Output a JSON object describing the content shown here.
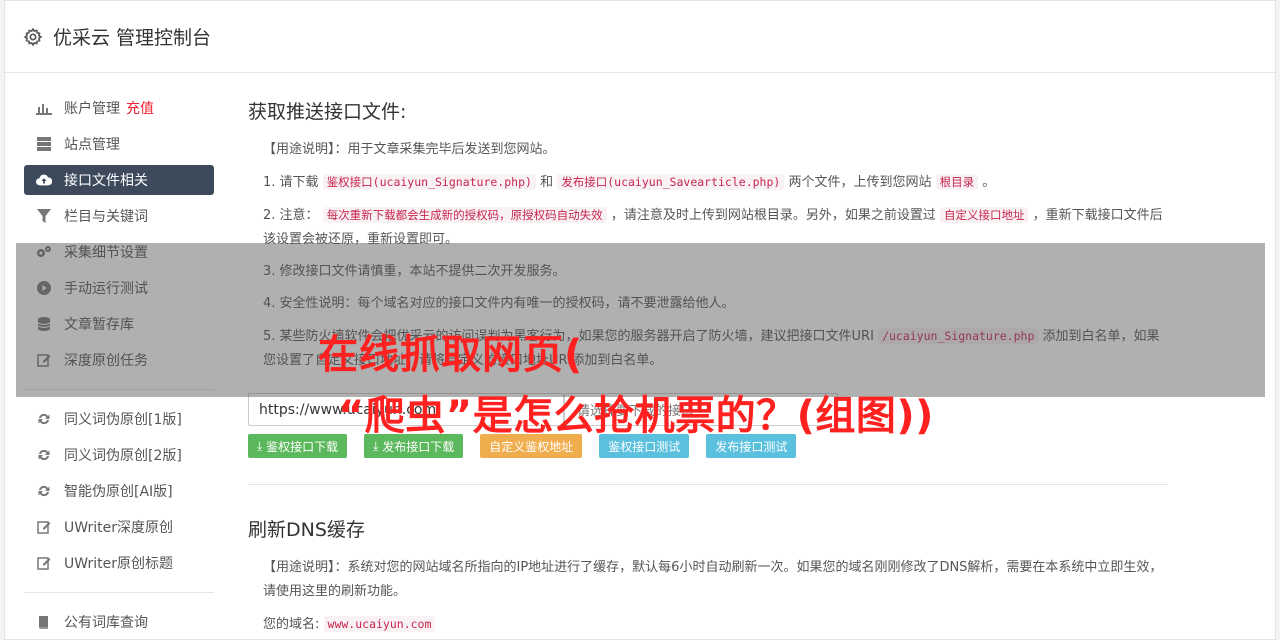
{
  "header": {
    "title": "优采云 管理控制台"
  },
  "sidebar": {
    "group1": [
      {
        "label": "账户管理",
        "badge": "充值",
        "icon": "bar-chart-icon"
      },
      {
        "label": "站点管理",
        "icon": "server-icon"
      },
      {
        "label": "接口文件相关",
        "icon": "cloud-upload-icon",
        "active": true
      },
      {
        "label": "栏目与关键词",
        "icon": "filter-icon"
      },
      {
        "label": "采集细节设置",
        "icon": "gears-icon"
      },
      {
        "label": "手动运行测试",
        "icon": "play-icon"
      },
      {
        "label": "文章暂存库",
        "icon": "database-icon"
      },
      {
        "label": "深度原创任务",
        "icon": "edit-icon"
      }
    ],
    "group2": [
      {
        "label": "同义词伪原创[1版]",
        "icon": "refresh-icon"
      },
      {
        "label": "同义词伪原创[2版]",
        "icon": "refresh-icon"
      },
      {
        "label": "智能伪原创[AI版]",
        "icon": "refresh-icon"
      },
      {
        "label": "UWriter深度原创",
        "icon": "edit-icon"
      },
      {
        "label": "UWriter原创标题",
        "icon": "edit-icon"
      }
    ],
    "group3": [
      {
        "label": "公有词库查询",
        "icon": "book-icon"
      }
    ]
  },
  "section1": {
    "title": "获取推送接口文件:",
    "usage": "【用途说明】：用于文章采集完毕后发送到您网站。",
    "step1_prefix": "1. 请下载",
    "step1_code1": "鉴权接口(ucaiyun_Signature.php)",
    "step1_and": "和",
    "step1_code2": "发布接口(ucaiyun_Savearticle.php)",
    "step1_suffix": "两个文件，上传到您网站",
    "step1_code3": "根目录",
    "step1_end": "。",
    "step2_prefix": "2. 注意：",
    "step2_code1": "每次重新下载都会生成新的授权码，原授权码自动失效",
    "step2_mid": "，请注意及时上传到网站根目录。另外，如果之前设置过",
    "step2_code2": "自定义接口地址",
    "step2_suffix": "，重新下载接口文件后该设置会被还原，重新设置即可。",
    "step3": "3. 修改接口文件请慎重，本站不提供二次开发服务。",
    "step4": "4. 安全性说明：每个域名对应的接口文件内有唯一的授权码，请不要泄露给他人。",
    "step5_prefix": "5. 某些防火墙软件会把优采云的访问误判为黑客行为，如果您的服务器开启了防火墙，建议把接口文件URI",
    "step5_code": "/ucaiyun_Signature.php",
    "step5_suffix": "添加到白名单，如果您设置了自定义接口地址，请将自定义的接口地址URI添加到白名单。",
    "url_value": "https://www.ucaiyun.com",
    "select_placeholder": "请选择要下载的接口",
    "buttons": {
      "download_auth": "鉴权接口下载",
      "download_publish": "发布接口下载",
      "custom_auth": "自定义鉴权地址",
      "test_auth": "鉴权接口测试",
      "test_publish": "发布接口测试"
    }
  },
  "section2": {
    "title": "刷新DNS缓存",
    "usage": "【用途说明】：系统对您的网站域名所指向的IP地址进行了缓存，默认每6小时自动刷新一次。如果您的域名刚刚修改了DNS解析，需要在本系统中立即生效，请使用这里的刷新功能。",
    "domain_label": "您的域名:",
    "domain_value": "www.ucaiyun.com"
  },
  "overlay": {
    "line1": "在线抓取网页(",
    "line2": "“爬虫”是怎么抢机票的？(组图))"
  },
  "colors": {
    "accent": "#3d4a5c",
    "green": "#5cb85c",
    "orange": "#f0ad4e",
    "blue": "#5bc0de",
    "overlay_text": "#ff2020"
  }
}
